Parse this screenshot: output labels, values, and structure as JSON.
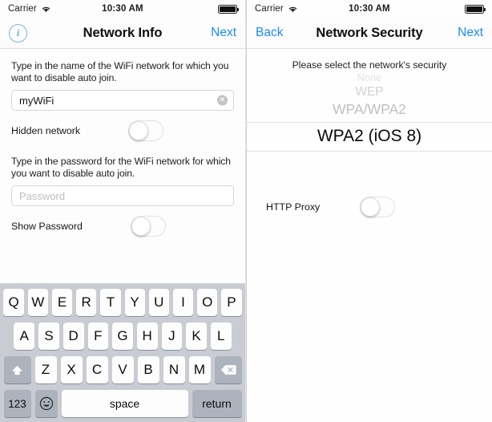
{
  "left": {
    "status_bar": {
      "carrier": "Carrier",
      "wifi_icon": "wifi-icon",
      "time": "10:30 AM",
      "battery_icon": "battery-full-icon"
    },
    "nav": {
      "left_icon": "info-circle-icon",
      "left_icon_glyph": "i",
      "title": "Network Info",
      "right_label": "Next"
    },
    "ssid_section": {
      "label": "Type in the name of the WiFi network for which you want to disable auto join.",
      "value": "myWiFi",
      "placeholder": "",
      "clear_icon": "clear-circle-icon",
      "clear_glyph": "✕"
    },
    "hidden_network": {
      "label": "Hidden network",
      "state": "off"
    },
    "password_section": {
      "label": "Type in the password for the WiFi network for which you want to disable auto join.",
      "value": "",
      "placeholder": "Password"
    },
    "show_password": {
      "label": "Show Password",
      "state": "off"
    },
    "keyboard": {
      "row1": [
        "Q",
        "W",
        "E",
        "R",
        "T",
        "Y",
        "U",
        "I",
        "O",
        "P"
      ],
      "row2": [
        "A",
        "S",
        "D",
        "F",
        "G",
        "H",
        "J",
        "K",
        "L"
      ],
      "row3": [
        "Z",
        "X",
        "C",
        "V",
        "B",
        "N",
        "M"
      ],
      "shift_icon": "shift-arrow-icon",
      "backspace_icon": "backspace-icon",
      "numbers_label": "123",
      "emoji_icon": "emoji-smiley-icon",
      "space_label": "space",
      "return_label": "return"
    }
  },
  "right": {
    "status_bar": {
      "carrier": "Carrier",
      "wifi_icon": "wifi-icon",
      "time": "10:30 AM",
      "battery_icon": "battery-full-icon"
    },
    "nav": {
      "left_label": "Back",
      "title": "Network Security",
      "right_label": "Next"
    },
    "prompt": "Please select the network's security",
    "picker": {
      "options": [
        "None",
        "WEP",
        "WPA/WPA2",
        "WPA2 (iOS 8)"
      ],
      "selected": "WPA2 (iOS 8)",
      "selected_index": 3
    },
    "http_proxy": {
      "label": "HTTP Proxy",
      "state": "off"
    }
  },
  "colors": {
    "accent_blue": "#1a8cff",
    "keyboard_bg": "#c9ccd2",
    "key_white": "#fdfdfd",
    "key_dark": "#adb3bd",
    "text_primary": "#0f0f0f",
    "placeholder": "#bdbdbf"
  }
}
